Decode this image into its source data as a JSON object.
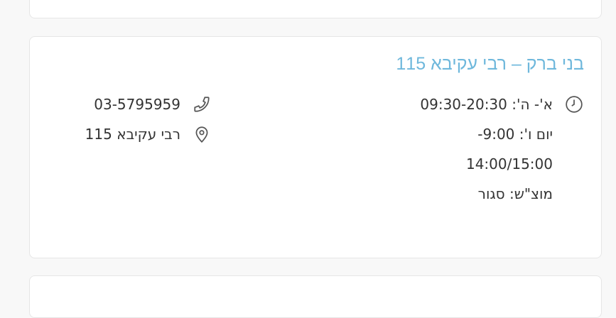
{
  "branch": {
    "title": "בני ברק – רבי עקיבא 115",
    "hours": {
      "line1": "א'- ה': 09:30-20:30",
      "line2": "יום ו': 9:00-",
      "line3": "14:00/15:00",
      "line4": "מוצ\"ש: סגור"
    },
    "phone": "03-5795959",
    "address": "רבי עקיבא 115"
  },
  "icons": {
    "hours": "clock-icon",
    "phone": "phone-icon",
    "address": "location-pin-icon"
  },
  "colors": {
    "title": "#6fb8dc",
    "card_border": "#e6e6e6",
    "background": "#f8f8f8"
  }
}
